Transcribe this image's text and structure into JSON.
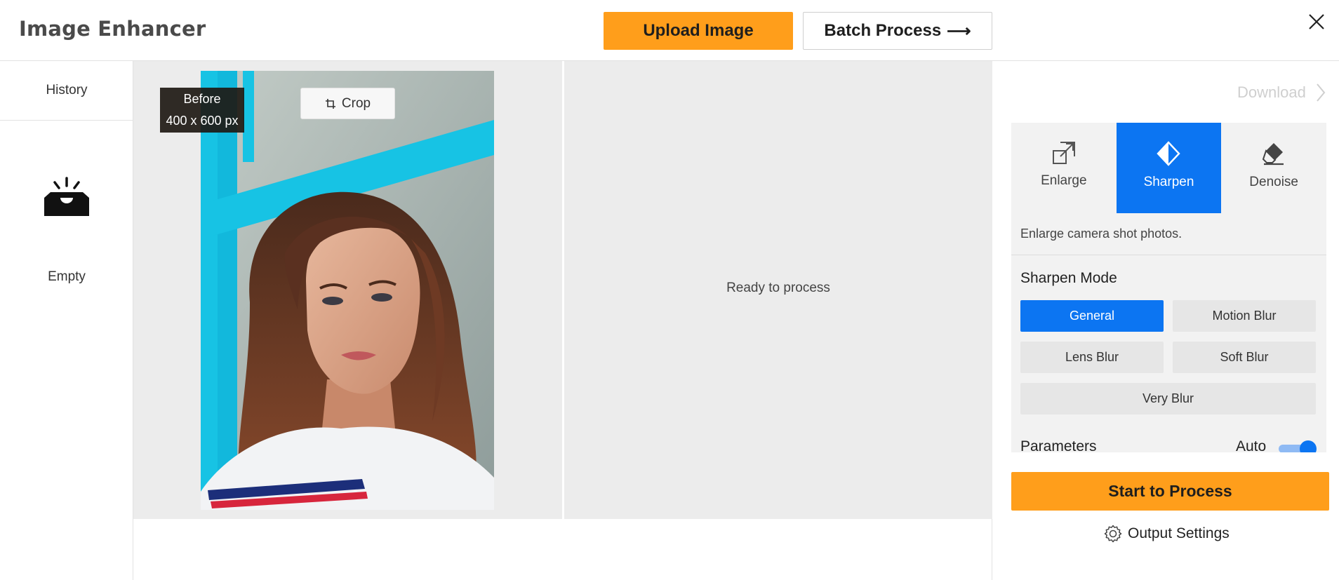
{
  "header": {
    "app_title": "Image Enhancer",
    "upload_label": "Upload Image",
    "batch_label": "Batch Process",
    "batch_arrow": "⟶"
  },
  "sidebar": {
    "history_label": "History",
    "empty_label": "Empty"
  },
  "canvas": {
    "before_label": "Before",
    "dimensions": "400 x 600 px",
    "crop_label": "Crop",
    "ready_text": "Ready to process"
  },
  "right_panel": {
    "download_label": "Download",
    "tabs": [
      {
        "label": "Enlarge",
        "icon": "enlarge-icon",
        "active": false
      },
      {
        "label": "Sharpen",
        "icon": "sharpen-icon",
        "active": true
      },
      {
        "label": "Denoise",
        "icon": "eraser-icon",
        "active": false
      }
    ],
    "description": "Enlarge camera shot photos.",
    "mode_title": "Sharpen Mode",
    "modes": [
      {
        "label": "General",
        "active": true
      },
      {
        "label": "Motion Blur",
        "active": false
      },
      {
        "label": "Lens Blur",
        "active": false
      },
      {
        "label": "Soft Blur",
        "active": false
      },
      {
        "label": "Very Blur",
        "active": false
      }
    ],
    "parameters_label": "Parameters",
    "auto_label": "Auto",
    "auto_enabled": true,
    "start_label": "Start to Process",
    "output_settings_label": "Output Settings"
  },
  "colors": {
    "accent_orange": "#ff9e1b",
    "accent_blue": "#0c75f2",
    "panel_gray": "#f2f2f2",
    "canvas_gray": "#ececec"
  }
}
